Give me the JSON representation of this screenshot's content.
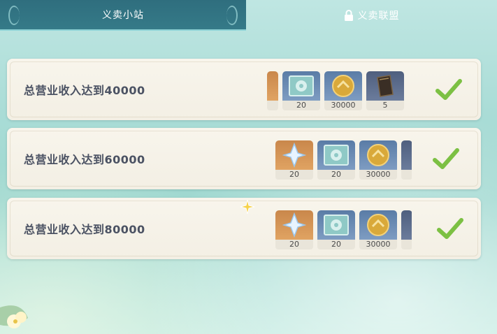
{
  "tabs": {
    "active_label": "义卖小站",
    "locked_label": "义卖联盟",
    "lock_icon": "lock-icon"
  },
  "tasks": [
    {
      "label": "总营业收入达到40000",
      "status": "completed",
      "rewards": [
        {
          "icon": "partial-orange-item-icon",
          "qty": ""
        },
        {
          "icon": "mora-note-icon",
          "qty": "20"
        },
        {
          "icon": "mora-coin-icon",
          "qty": "30000"
        },
        {
          "icon": "book-icon",
          "qty": "5"
        }
      ]
    },
    {
      "label": "总营业收入达到60000",
      "status": "completed",
      "rewards": [
        {
          "icon": "primogem-icon",
          "qty": "20"
        },
        {
          "icon": "mora-note-icon",
          "qty": "20"
        },
        {
          "icon": "mora-coin-icon",
          "qty": "30000"
        },
        {
          "icon": "partial-dark-item-icon",
          "qty": ""
        }
      ]
    },
    {
      "label": "总营业收入达到80000",
      "status": "completed",
      "rewards": [
        {
          "icon": "primogem-icon",
          "qty": "20"
        },
        {
          "icon": "mora-note-icon",
          "qty": "20"
        },
        {
          "icon": "mora-coin-icon",
          "qty": "30000"
        },
        {
          "icon": "partial-dark-item-icon",
          "qty": ""
        }
      ]
    }
  ],
  "colors": {
    "tab_active": "#357a88",
    "check": "#7cc043",
    "label_text": "#4b5263"
  }
}
